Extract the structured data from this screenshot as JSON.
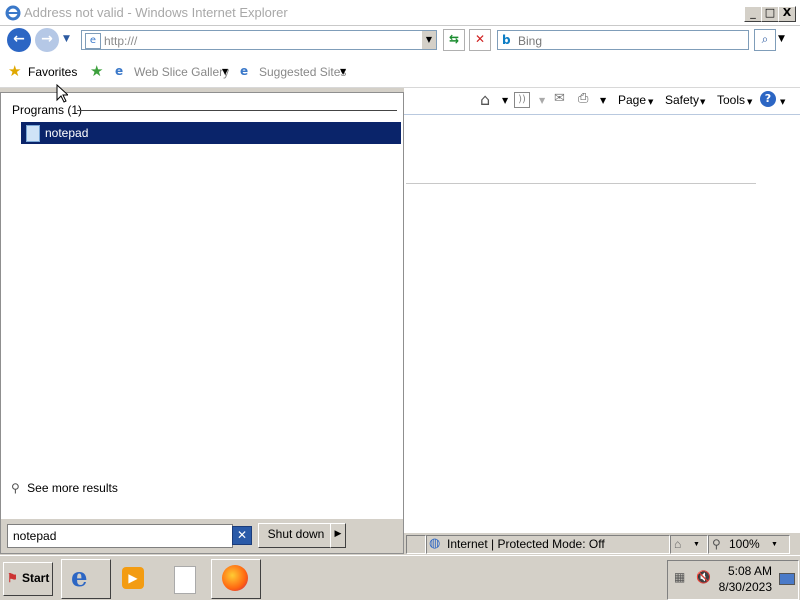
{
  "window": {
    "title": "Address not valid - Windows Internet Explorer",
    "min": "_",
    "max": "□",
    "close": "X"
  },
  "nav": {
    "address": "http:///",
    "search_placeholder": "Bing"
  },
  "favbar": {
    "favorites": "Favorites",
    "web_slice": "Web Slice Gallery",
    "suggested": "Suggested Sites"
  },
  "cmdbar": {
    "page": "Page",
    "safety": "Safety",
    "tools": "Tools"
  },
  "start_menu": {
    "programs_header": "Programs (1)",
    "program_items": [
      "notepad"
    ],
    "see_more": "See more results",
    "search_value": "notepad",
    "shutdown": "Shut down"
  },
  "statusbar": {
    "zone": "Internet | Protected Mode: Off",
    "zoom": "100%"
  },
  "taskbar": {
    "start": "Start",
    "time": "5:08 AM",
    "date": "8/30/2023"
  },
  "colors": {
    "selection": "#0a246a",
    "chrome": "#d4d0c8"
  }
}
